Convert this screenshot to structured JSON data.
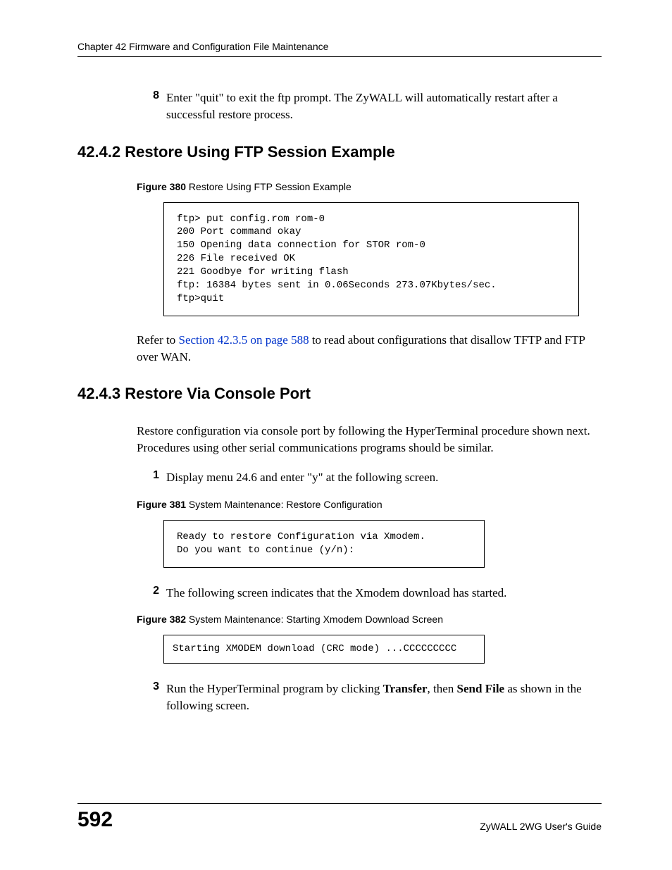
{
  "header": {
    "chapter": "Chapter 42 Firmware and Configuration File Maintenance"
  },
  "step8": {
    "num": "8",
    "text": "Enter \"quit\" to exit the ftp prompt. The ZyWALL will automatically restart after a successful restore process."
  },
  "section1": {
    "heading": "42.4.2  Restore Using FTP Session Example",
    "fig_label_bold": "Figure 380",
    "fig_label_rest": "   Restore Using FTP Session Example",
    "code": "ftp> put config.rom rom-0\n200 Port command okay\n150 Opening data connection for STOR rom-0\n226 File received OK\n221 Goodbye for writing flash\nftp: 16384 bytes sent in 0.06Seconds 273.07Kbytes/sec.\nftp>quit",
    "after_para_prefix": "Refer to ",
    "after_para_link": "Section 42.3.5 on page 588",
    "after_para_suffix": " to read about configurations that disallow TFTP and FTP over WAN."
  },
  "section2": {
    "heading": "42.4.3  Restore Via Console Port",
    "intro": "Restore configuration via console port by following the HyperTerminal procedure shown next. Procedures using other serial communications programs should be similar.",
    "step1": {
      "num": "1",
      "text": "Display menu 24.6 and enter \"y\" at the following screen."
    },
    "fig381_bold": "Figure 381",
    "fig381_rest": "   System Maintenance: Restore Configuration",
    "code381": "Ready to restore Configuration via Xmodem.\nDo you want to continue (y/n):",
    "step2": {
      "num": "2",
      "text": "The following screen indicates that the Xmodem download has started."
    },
    "fig382_bold": "Figure 382",
    "fig382_rest": "   System Maintenance: Starting Xmodem Download Screen",
    "code382": "Starting XMODEM download (CRC mode) ...CCCCCCCCC",
    "step3": {
      "num": "3",
      "text_pre": "Run the HyperTerminal program by clicking ",
      "bold1": "Transfer",
      "mid": ", then ",
      "bold2": "Send File",
      "text_post": " as shown in the following screen."
    }
  },
  "footer": {
    "page": "592",
    "guide": "ZyWALL 2WG User's Guide"
  }
}
